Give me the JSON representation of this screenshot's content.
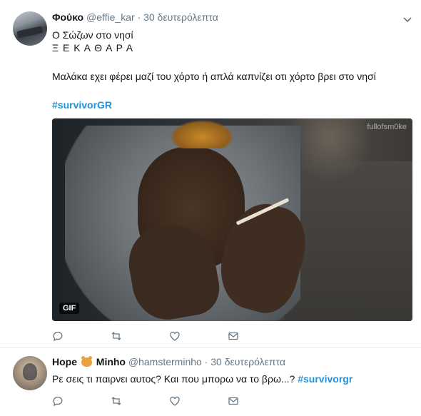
{
  "tweets": [
    {
      "name": "Φούκο",
      "handle": "@effie_kar",
      "separator": "·",
      "time": "30 δευτερόλεπτα",
      "lines": [
        "Ο Σώζων στο νησί",
        "Ξ Ε Κ Α Θ Α Ρ Α",
        "Μαλάκα εχει φέρει μαζί του χόρτο ή απλά καπνίζει οτι χόρτο βρει στο νησί"
      ],
      "hashtag": "#survivorGR",
      "media": {
        "watermark": "fullofsm0ke",
        "badge": "GIF"
      },
      "icons": {
        "reply": "reply-icon",
        "retweet": "retweet-icon",
        "like": "heart-icon",
        "dm": "envelope-icon",
        "more": "chevron-down-icon"
      }
    },
    {
      "name_part1": "Hope",
      "name_emoji": "hamster-emoji",
      "name_part2": "Minho",
      "handle": "@hamsterminho",
      "separator": "·",
      "time": "30 δευτερόλεπτα",
      "text": "Ρε σεις τι παιρνει αυτος? Και που μπορω να το βρω...?",
      "hashtag": "#survivorgr"
    }
  ],
  "colors": {
    "text": "#14171a",
    "secondary": "#657786",
    "link": "#1b95e0",
    "border": "#e6ecf0"
  }
}
